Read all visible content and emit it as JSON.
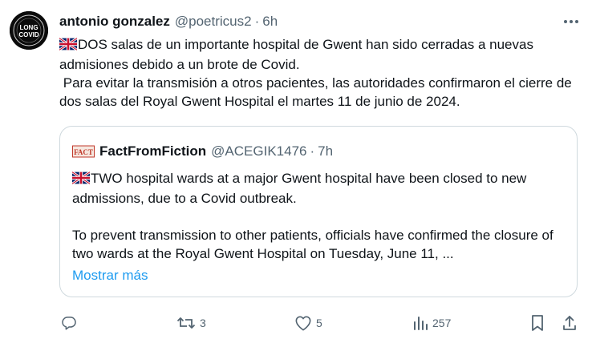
{
  "author": {
    "display_name": "antonio gonzalez",
    "handle": "@poetricus2",
    "separator": "·",
    "time": "6h",
    "avatar_text_top": "LONG",
    "avatar_text_bottom": "COVID"
  },
  "tweet": {
    "line1": "DOS salas de un importante hospital de Gwent han sido cerradas a nuevas admisiones debido a un brote de Covid.",
    "line2": " Para evitar la transmisión a otros pacientes, las autoridades confirmaron el cierre de dos salas del Royal Gwent Hospital el martes 11 de junio de 2024."
  },
  "quote": {
    "avatar_text": "FACT",
    "display_name": "FactFromFiction",
    "handle": "@ACEGIK1476",
    "separator": "·",
    "time": "7h",
    "para1": "TWO hospital wards at a major Gwent hospital have been closed to new admissions, due to a Covid outbreak.",
    "para2": "To prevent transmission to other patients, officials have confirmed the closure of two wards at the Royal Gwent Hospital on Tuesday, June 11, ...",
    "show_more": "Mostrar más"
  },
  "actions": {
    "reply_count": "",
    "retweet_count": "3",
    "like_count": "5",
    "views_count": "257"
  },
  "icons": [
    "more-icon",
    "uk-flag-icon",
    "reply-icon",
    "retweet-icon",
    "like-icon",
    "views-icon",
    "bookmark-icon",
    "share-icon"
  ],
  "colors": {
    "text": "#0f1419",
    "secondary": "#536471",
    "link": "#1d9bf0",
    "border": "#cfd9de"
  }
}
